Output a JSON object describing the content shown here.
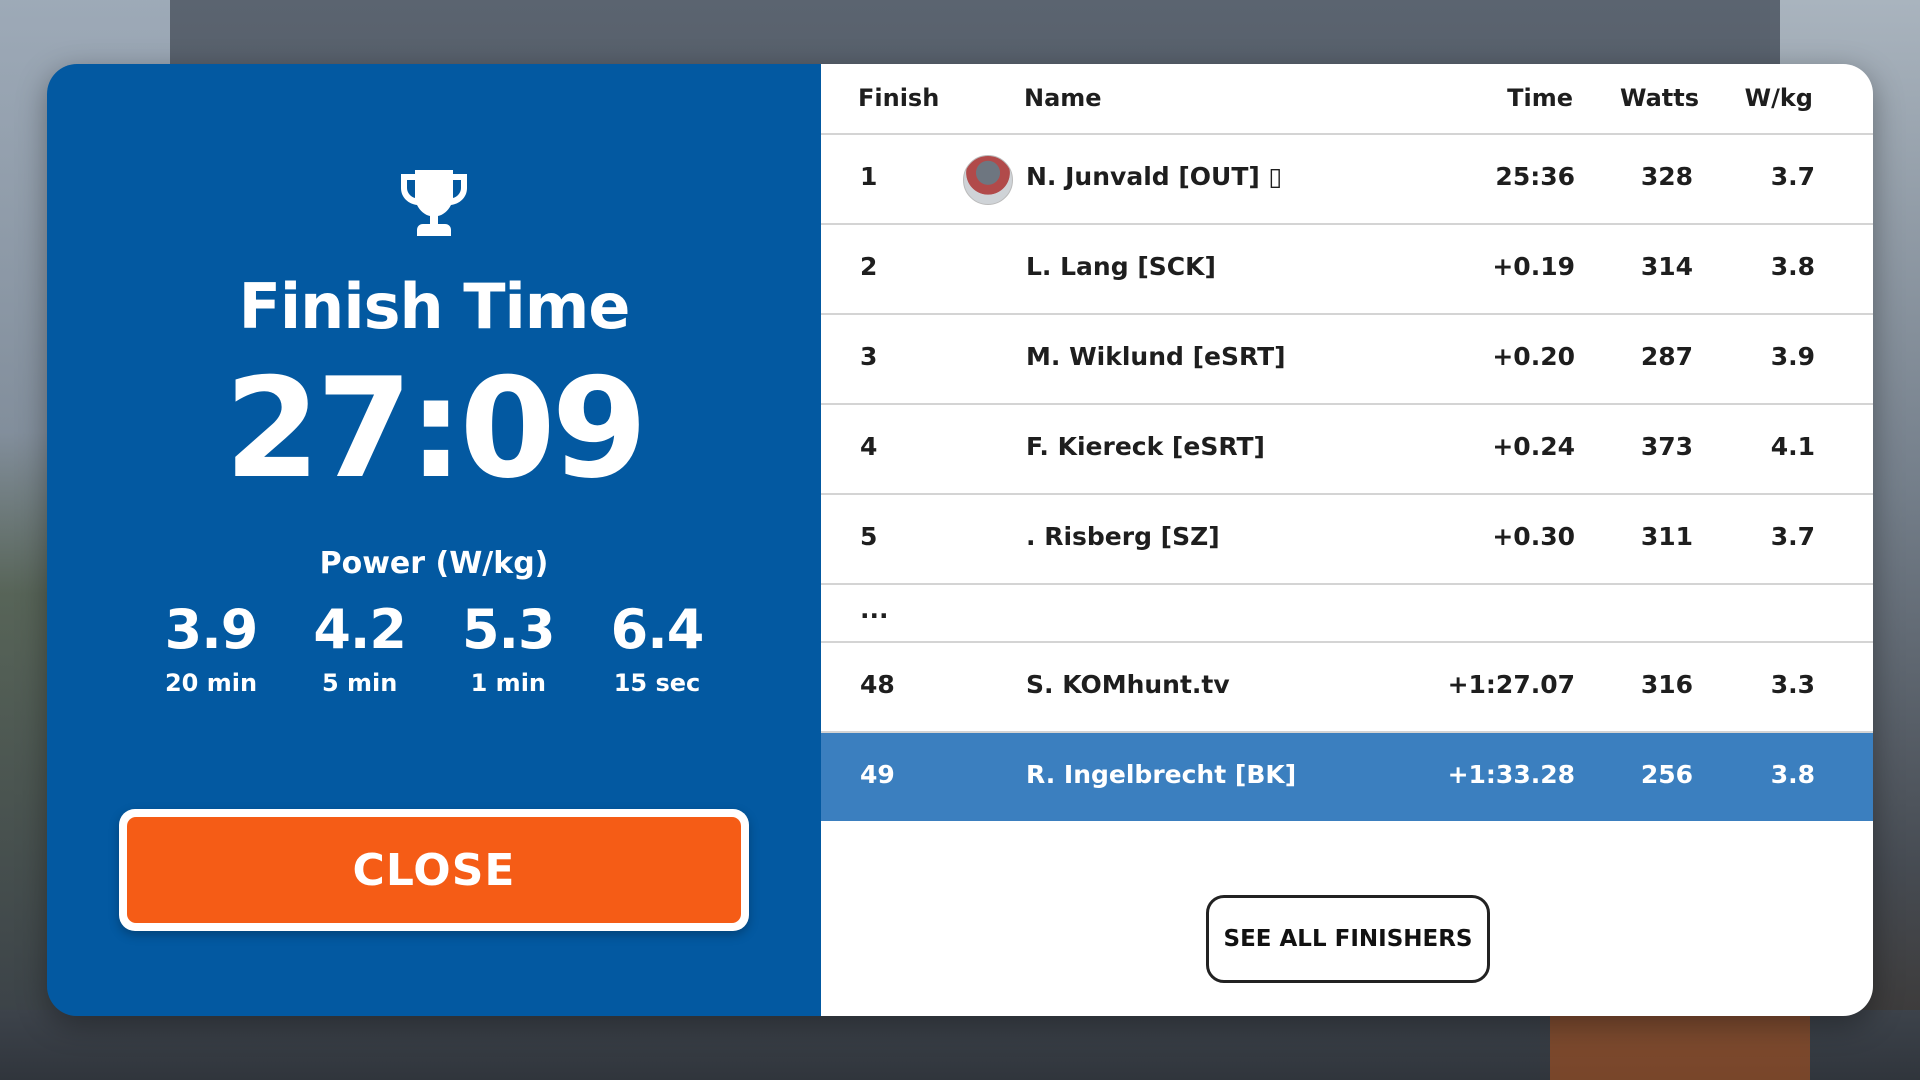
{
  "summary": {
    "title": "Finish Time",
    "time": "27:09",
    "power_title": "Power (W/kg)",
    "power": [
      {
        "value": "3.9",
        "label": "20 min"
      },
      {
        "value": "4.2",
        "label": "5 min"
      },
      {
        "value": "5.3",
        "label": "1 min"
      },
      {
        "value": "6.4",
        "label": "15 sec"
      }
    ],
    "close_label": "CLOSE",
    "trophy_icon": "trophy-icon"
  },
  "results": {
    "headers": {
      "finish": "Finish",
      "name": "Name",
      "time": "Time",
      "watts": "Watts",
      "wkg": "W/kg"
    },
    "rows": [
      {
        "pos": "1",
        "name": "N. Junvald [OUT] ▯",
        "time": "25:36",
        "watts": "328",
        "wkg": "3.7"
      },
      {
        "pos": "2",
        "name": "L. Lang [SCK]",
        "time": "+0.19",
        "watts": "314",
        "wkg": "3.8"
      },
      {
        "pos": "3",
        "name": "M. Wiklund [eSRT]",
        "time": "+0.20",
        "watts": "287",
        "wkg": "3.9"
      },
      {
        "pos": "4",
        "name": "F. Kiereck [eSRT]",
        "time": "+0.24",
        "watts": "373",
        "wkg": "4.1"
      },
      {
        "pos": "5",
        "name": ". Risberg [SZ]",
        "time": "+0.30",
        "watts": "311",
        "wkg": "3.7"
      }
    ],
    "ellipsis": "...",
    "tail_rows": [
      {
        "pos": "48",
        "name": "S. KOMhunt.tv",
        "time": "+1:27.07",
        "watts": "316",
        "wkg": "3.3"
      },
      {
        "pos": "49",
        "name": "R. Ingelbrecht [BK]",
        "time": "+1:33.28",
        "watts": "256",
        "wkg": "3.8"
      }
    ],
    "see_all_label": "SEE ALL FINISHERS",
    "highlight_color": "#3b7fbf"
  },
  "colors": {
    "panel_blue": "#0359a1",
    "close_orange": "#f55c16"
  }
}
